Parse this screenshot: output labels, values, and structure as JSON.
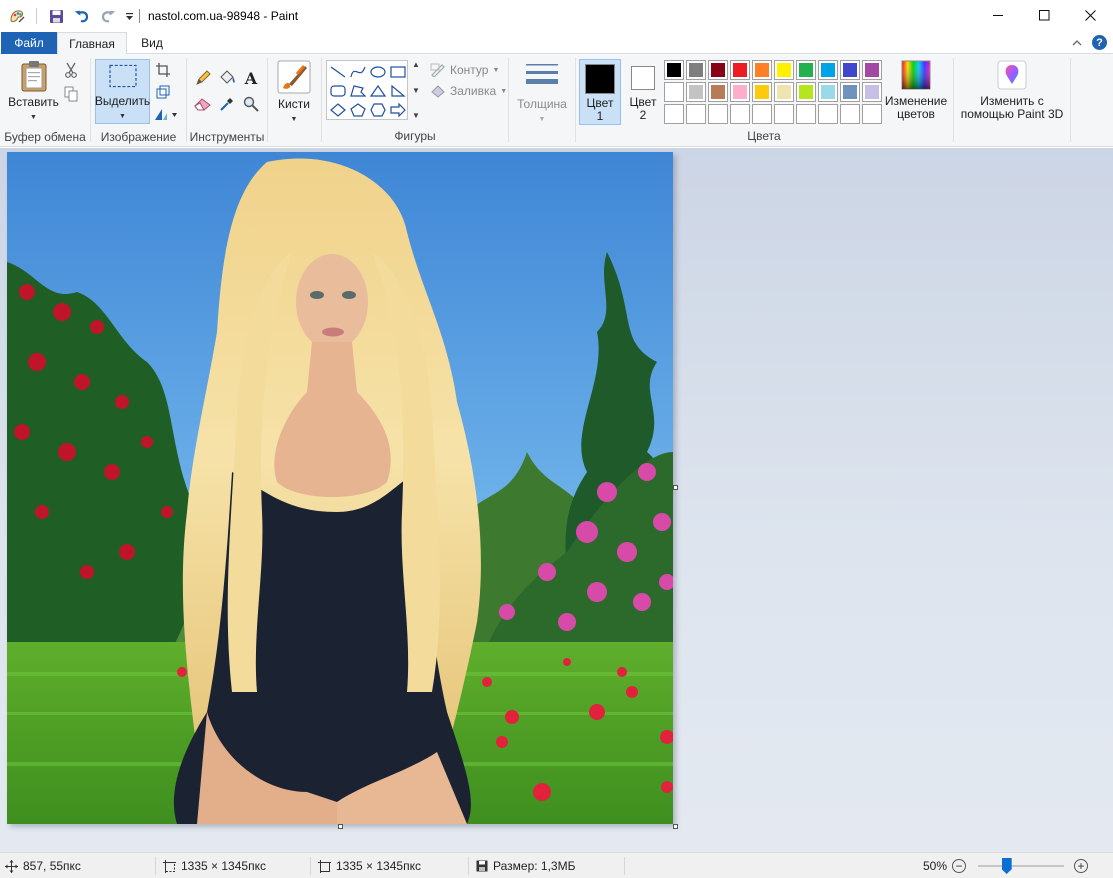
{
  "window": {
    "title": "nastol.com.ua-98948 - Paint"
  },
  "tabs": {
    "file": "Файл",
    "home": "Главная",
    "view": "Вид"
  },
  "ribbon": {
    "clipboard": {
      "paste": "Вставить",
      "group": "Буфер обмена"
    },
    "image": {
      "select": "Выделить",
      "group": "Изображение"
    },
    "tools": {
      "group": "Инструменты"
    },
    "brushes": {
      "label": "Кисти"
    },
    "shapes": {
      "outline": "Контур",
      "fill": "Заливка",
      "group": "Фигуры"
    },
    "size": {
      "label": "Толщина"
    },
    "colors": {
      "color1_line1": "Цвет",
      "color1_line2": "1",
      "color2_line1": "Цвет",
      "color2_line2": "2",
      "edit_line1": "Изменение",
      "edit_line2": "цветов",
      "group": "Цвета",
      "color1": "#000000",
      "color2": "#ffffff",
      "palette_row1": [
        "#000000",
        "#7f7f7f",
        "#880015",
        "#ed1c24",
        "#ff7f27",
        "#fff200",
        "#22b14c",
        "#00a2e8",
        "#3f48cc",
        "#a349a4"
      ],
      "palette_row2": [
        "#ffffff",
        "#c3c3c3",
        "#b97a57",
        "#ffaec9",
        "#ffc90e",
        "#efe4b0",
        "#b5e61d",
        "#99d9ea",
        "#7092be",
        "#c8bfe7"
      ]
    },
    "paint3d": {
      "line1": "Изменить с",
      "line2": "помощью Paint 3D"
    }
  },
  "status": {
    "cursor": "857, 55пкс",
    "selection": "1335 × 1345пкс",
    "image_size": "1335 × 1345пкс",
    "file_size": "Размер: 1,3МБ",
    "zoom": "50%",
    "zoom_level": 0.5
  }
}
